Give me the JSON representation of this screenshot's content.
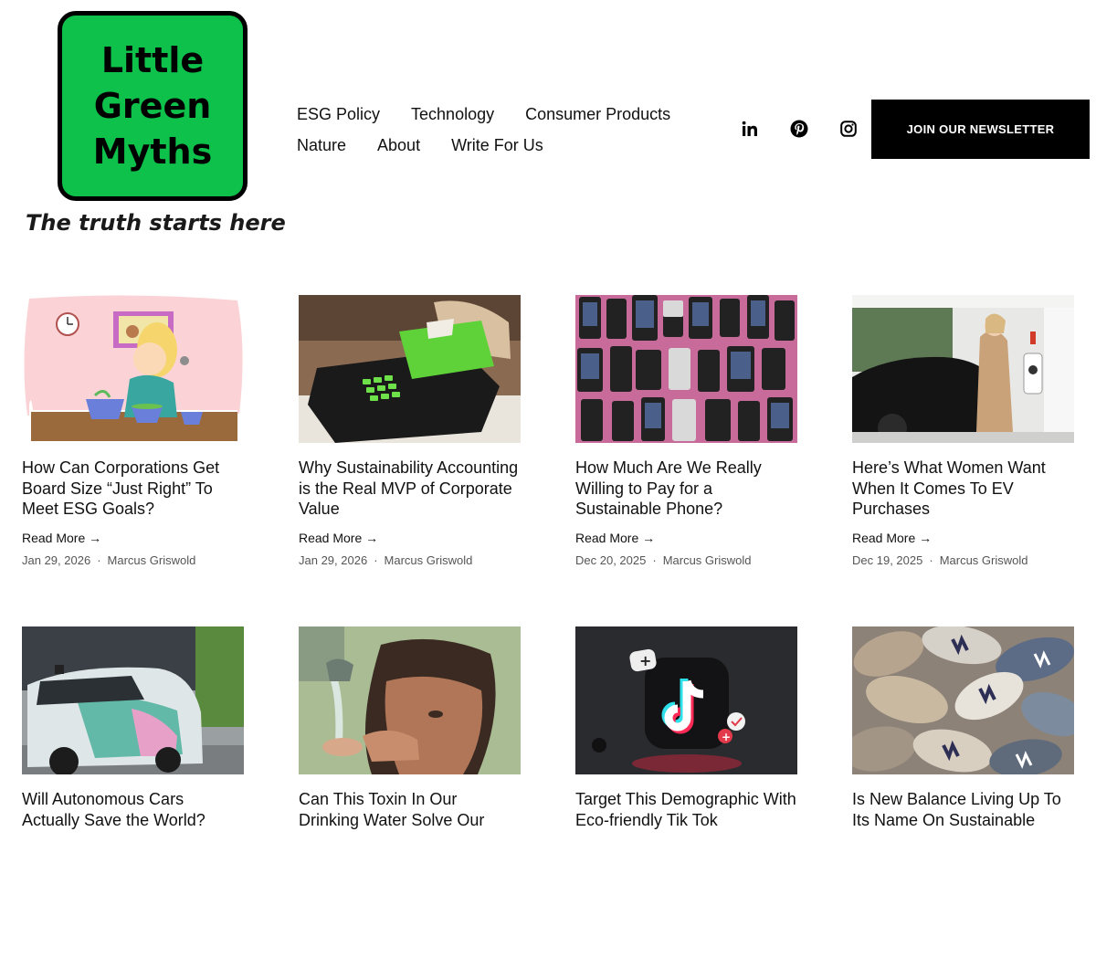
{
  "logo": {
    "lines": [
      "Little",
      "Green",
      "Myths"
    ],
    "tagline": "The truth starts here",
    "box_color": "#0ec14b"
  },
  "nav": {
    "row1": [
      "ESG Policy",
      "Technology",
      "Consumer Products"
    ],
    "row2": [
      "Nature",
      "About",
      "Write For Us"
    ]
  },
  "socials": [
    "linkedin-icon",
    "pinterest-icon",
    "instagram-icon"
  ],
  "newsletter_label": "JOIN OUR NEWSLETTER",
  "read_more_label": "Read More →",
  "articles": [
    {
      "title": "How Can Corporations Get Board Size “Just Right” To Meet ESG Goals?",
      "date": "Jan 29, 2026",
      "author": "Marcus Griswold"
    },
    {
      "title": "Why Sustainability Accounting is the Real MVP of Corporate Value",
      "date": "Jan 29, 2026",
      "author": "Marcus Griswold"
    },
    {
      "title": "How Much Are We Really Willing to Pay for a Sustainable Phone?",
      "date": "Dec 20, 2025",
      "author": "Marcus Griswold"
    },
    {
      "title": "Here’s What Women Want When It Comes To EV Purchases",
      "date": "Dec 19, 2025",
      "author": "Marcus Griswold"
    },
    {
      "title": "Will Autonomous Cars Actually Save the World?",
      "date": "",
      "author": ""
    },
    {
      "title": "Can This Toxin In Our Drinking Water Solve Our",
      "date": "",
      "author": ""
    },
    {
      "title": "Target This Demographic With Eco-friendly Tik Tok",
      "date": "",
      "author": ""
    },
    {
      "title": "Is New Balance Living Up To Its Name On Sustainable",
      "date": "",
      "author": ""
    }
  ]
}
